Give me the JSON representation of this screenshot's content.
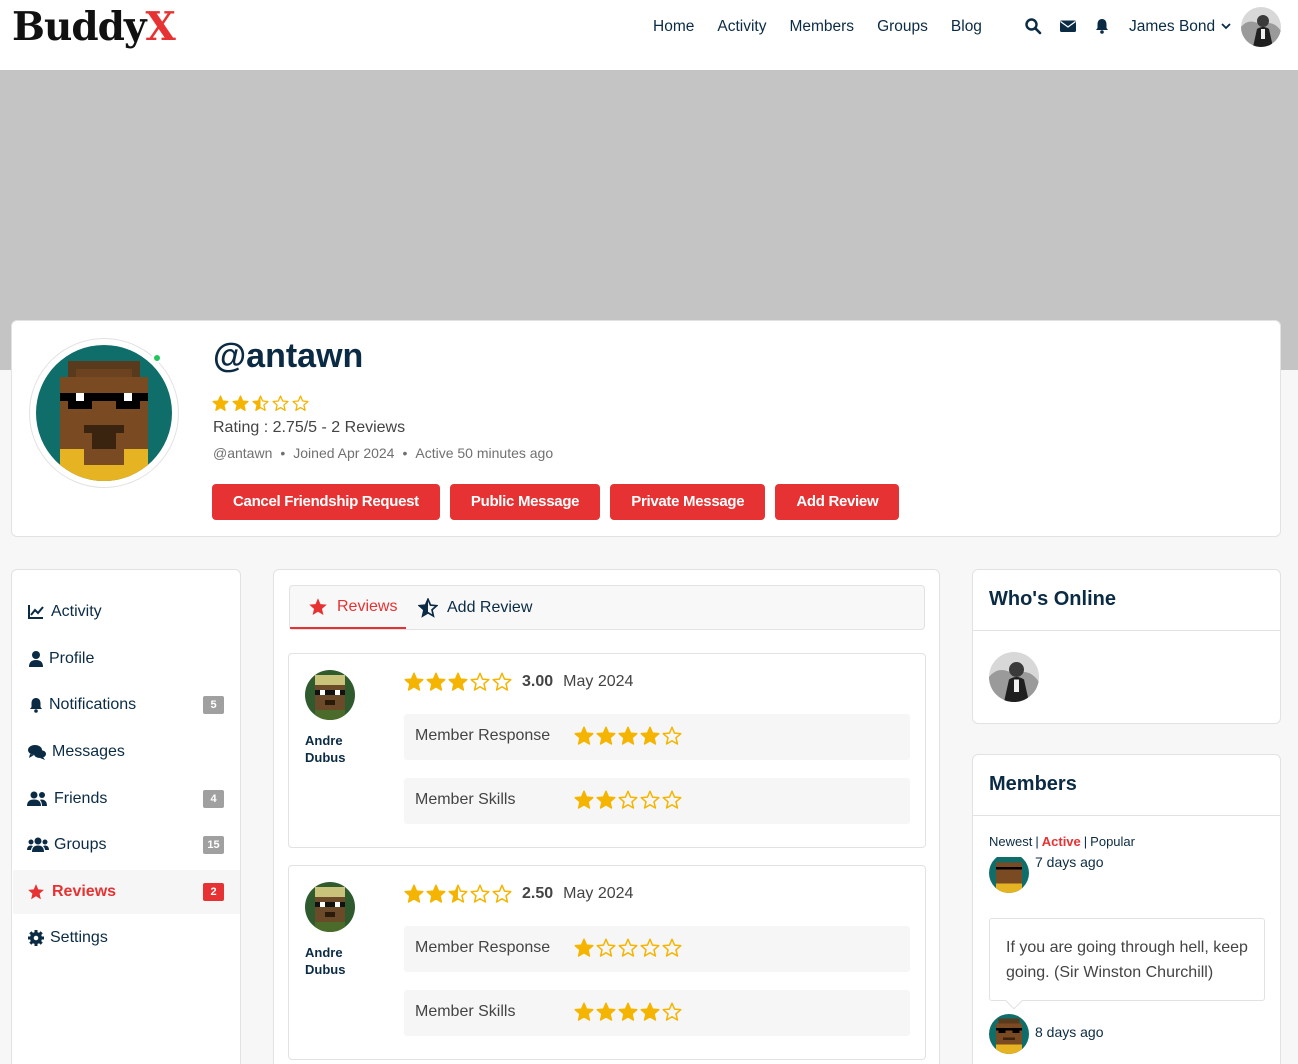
{
  "site": {
    "logo_main": "Buddy",
    "logo_accent": "X"
  },
  "nav": [
    "Home",
    "Activity",
    "Members",
    "Groups",
    "Blog"
  ],
  "header_icons": [
    "search-icon",
    "envelope-icon",
    "bell-icon"
  ],
  "user": {
    "name": "James Bond"
  },
  "profile": {
    "handle_title": "@antawn",
    "rating_stars": 2.75,
    "rating_text": "Rating : 2.75/5 - 2 Reviews",
    "meta": {
      "handle": "@antawn",
      "joined": "Joined Apr 2024",
      "active": "Active 50 minutes ago"
    },
    "buttons": [
      "Cancel Friendship Request",
      "Public Message",
      "Private Message",
      "Add Review"
    ]
  },
  "menu": [
    {
      "label": "Activity",
      "icon": "activity-chart-icon",
      "count": ""
    },
    {
      "label": "Profile",
      "icon": "user-icon",
      "count": ""
    },
    {
      "label": "Notifications",
      "icon": "bell-icon",
      "count": "5"
    },
    {
      "label": "Messages",
      "icon": "comments-icon",
      "count": ""
    },
    {
      "label": "Friends",
      "icon": "friends-icon",
      "count": "4"
    },
    {
      "label": "Groups",
      "icon": "groups-icon",
      "count": "15"
    },
    {
      "label": "Reviews",
      "icon": "star-icon",
      "count": "2",
      "active": true
    },
    {
      "label": "Settings",
      "icon": "gear-icon",
      "count": ""
    }
  ],
  "tabs": {
    "reviews": "Reviews",
    "add_review": "Add Review"
  },
  "reviews": [
    {
      "author": "Andre Dubus",
      "overall_stars": 3,
      "score": "3.00",
      "date": "May 2024",
      "criteria": [
        {
          "label": "Member Response",
          "stars": 4
        },
        {
          "label": "Member Skills",
          "stars": 2
        }
      ]
    },
    {
      "author": "Andre Dubus",
      "overall_stars": 2.5,
      "score": "2.50",
      "date": "May 2024",
      "criteria": [
        {
          "label": "Member Response",
          "stars": 1
        },
        {
          "label": "Member Skills",
          "stars": 4
        }
      ]
    }
  ],
  "whos_online": {
    "title": "Who's Online"
  },
  "members_widget": {
    "title": "Members",
    "filters": [
      "Newest",
      "Active",
      "Popular"
    ],
    "active_filter": "Active",
    "rows": [
      {
        "time": "7 days ago"
      },
      {
        "time": "8 days ago"
      }
    ],
    "quote": "If you are going through hell, keep going. (Sir Winston Churchill)"
  },
  "colors": {
    "accent": "#e63232",
    "navy": "#0b2b45",
    "star": "#f5b400",
    "cover": "#c4c4c4",
    "online": "#22c55e"
  }
}
